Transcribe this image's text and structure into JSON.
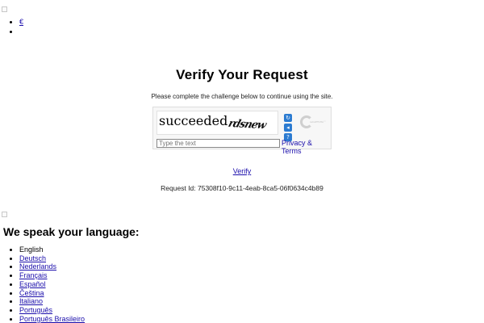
{
  "top_nav": {
    "items": [
      "€",
      ""
    ]
  },
  "main": {
    "title": "Verify Your Request",
    "subtitle": "Please complete the challenge below to continue using the site.",
    "captcha": {
      "word1": "succeeded",
      "word2": "rdsnew",
      "input_placeholder": "Type the text",
      "privacy_link": "Privacy & Terms",
      "refresh_icon": "refresh-icon",
      "audio_icon": "audio-icon",
      "help_icon": "help-icon",
      "logo_text": "reCAPTCHA™"
    },
    "verify_link": "Verify",
    "request_id": "Request Id: 75308f10-9c11-4eab-8ca5-06f0634c4b89"
  },
  "languages": {
    "heading": "We speak your language:",
    "items": [
      "English",
      "Deutsch",
      "Nederlands",
      "Français",
      "Español",
      "Čeština",
      "Italiano",
      "Português",
      "Português Brasileiro"
    ]
  }
}
